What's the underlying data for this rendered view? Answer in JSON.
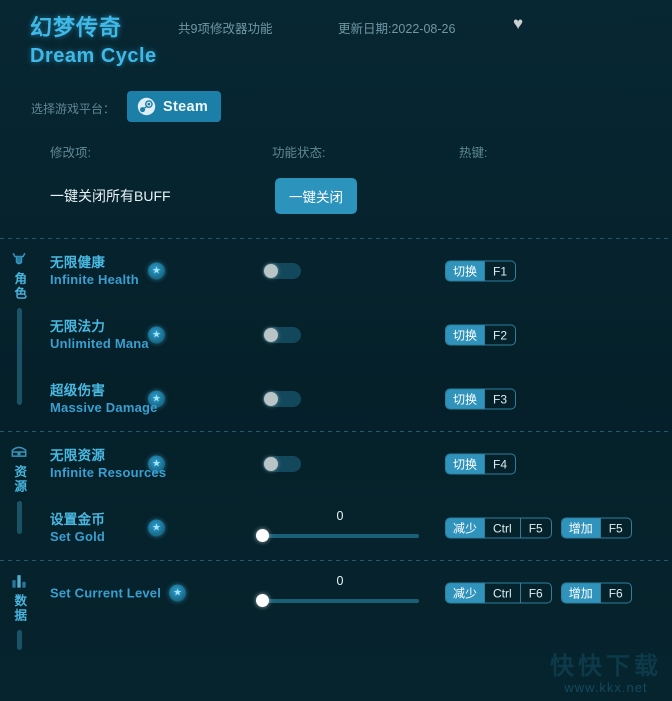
{
  "header": {
    "title_cn": "幻梦传奇",
    "title_en": "Dream Cycle",
    "feature_count": "共9项修改器功能",
    "update_date": "更新日期:2022-08-26",
    "favorite_icon": "♥"
  },
  "platform": {
    "label": "选择游戏平台：",
    "selected": "Steam"
  },
  "columns": {
    "modifier": "修改项:",
    "status": "功能状态:",
    "hotkey": "热键:"
  },
  "onekey": {
    "label": "一键关闭所有BUFF",
    "button": "一键关闭"
  },
  "sections": [
    {
      "name": "角色",
      "icon": "helmet-icon",
      "rows": [
        {
          "name_cn": "无限健康",
          "name_en": "Infinite Health",
          "control": "toggle",
          "toggle_state": "off",
          "keys": [
            {
              "action": "切换",
              "caps": [
                "F1"
              ]
            }
          ]
        },
        {
          "name_cn": "无限法力",
          "name_en": "Unlimited Mana",
          "control": "toggle",
          "toggle_state": "off",
          "keys": [
            {
              "action": "切换",
              "caps": [
                "F2"
              ]
            }
          ]
        },
        {
          "name_cn": "超级伤害",
          "name_en": "Massive Damage",
          "control": "toggle",
          "toggle_state": "off",
          "keys": [
            {
              "action": "切换",
              "caps": [
                "F3"
              ]
            }
          ]
        }
      ]
    },
    {
      "name": "资源",
      "icon": "chest-icon",
      "rows": [
        {
          "name_cn": "无限资源",
          "name_en": "Infinite Resources",
          "control": "toggle",
          "toggle_state": "off",
          "keys": [
            {
              "action": "切换",
              "caps": [
                "F4"
              ]
            }
          ]
        },
        {
          "name_cn": "设置金币",
          "name_en": "Set Gold",
          "control": "slider",
          "slider_value": "0",
          "keys": [
            {
              "action": "减少",
              "caps": [
                "Ctrl",
                "F5"
              ]
            },
            {
              "action": "增加",
              "caps": [
                "F5"
              ]
            }
          ]
        }
      ]
    },
    {
      "name": "数据",
      "icon": "bar-chart-icon",
      "rows": [
        {
          "name_cn": "",
          "name_en": "Set Current Level",
          "control": "slider",
          "slider_value": "0",
          "keys": [
            {
              "action": "减少",
              "caps": [
                "Ctrl",
                "F6"
              ]
            },
            {
              "action": "增加",
              "caps": [
                "F6"
              ]
            }
          ]
        }
      ]
    }
  ],
  "watermark": {
    "text_cn": "快快下载",
    "url": "www.kkx.net"
  },
  "colors": {
    "background": "#06242f",
    "accent": "#2f93bb",
    "title": "#3fb9e8",
    "label": "#5f8795"
  }
}
